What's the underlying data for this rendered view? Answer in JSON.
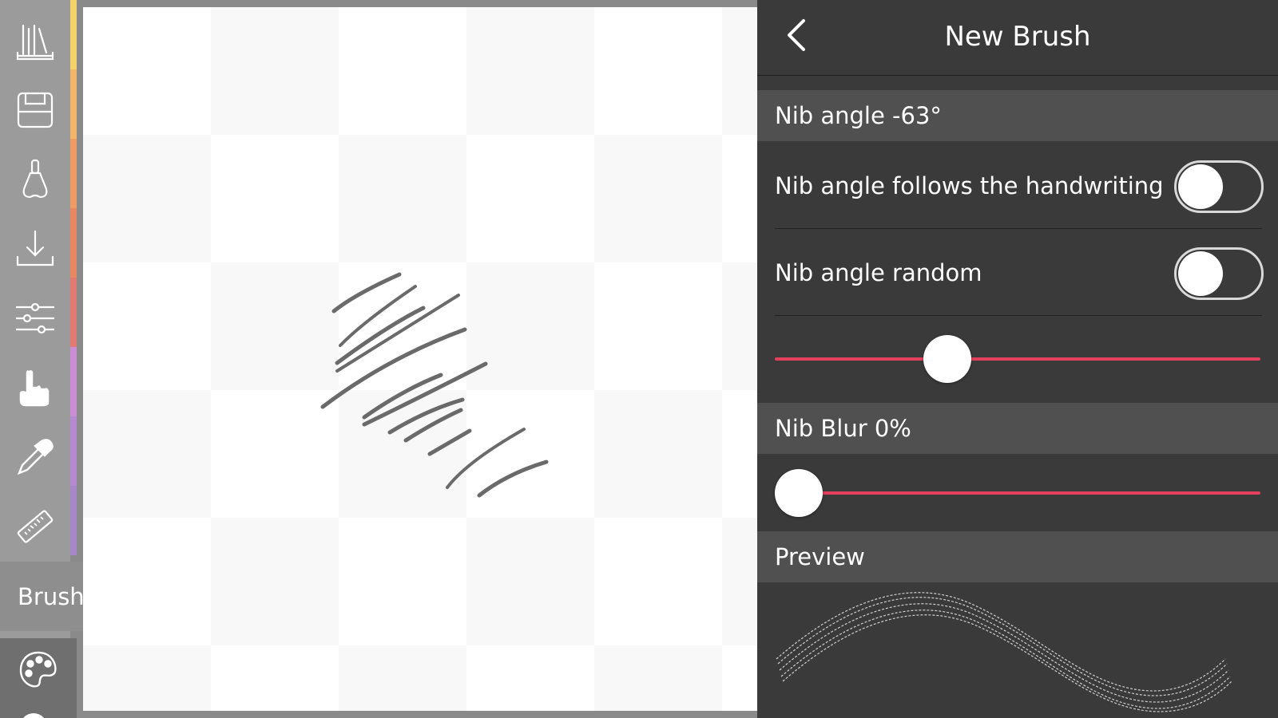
{
  "panel": {
    "title": "New Brush",
    "nib_angle_label": "Nib angle -63°",
    "follows_handwriting_label": "Nib angle follows the handwriting",
    "follows_handwriting_on": false,
    "random_label": "Nib angle random",
    "random_on": false,
    "nib_angle_slider_fraction": 0.34,
    "nib_blur_label": "Nib Blur 0%",
    "nib_blur_slider_fraction": 0.0,
    "preview_label": "Preview"
  },
  "toolbar": {
    "tools": [
      "library-icon",
      "save-icon",
      "brush-icon",
      "import-icon",
      "adjustments-icon",
      "hand-icon",
      "eyedropper-icon",
      "ruler-icon"
    ],
    "brush_tab_label": "Brush",
    "strip_colors": [
      "#f4d36a",
      "#f2b56a",
      "#ee9c64",
      "#e78862",
      "#e27a74",
      "#c98ed4",
      "#b58ad0",
      "#a887c9"
    ],
    "accent": "#e2405a"
  }
}
